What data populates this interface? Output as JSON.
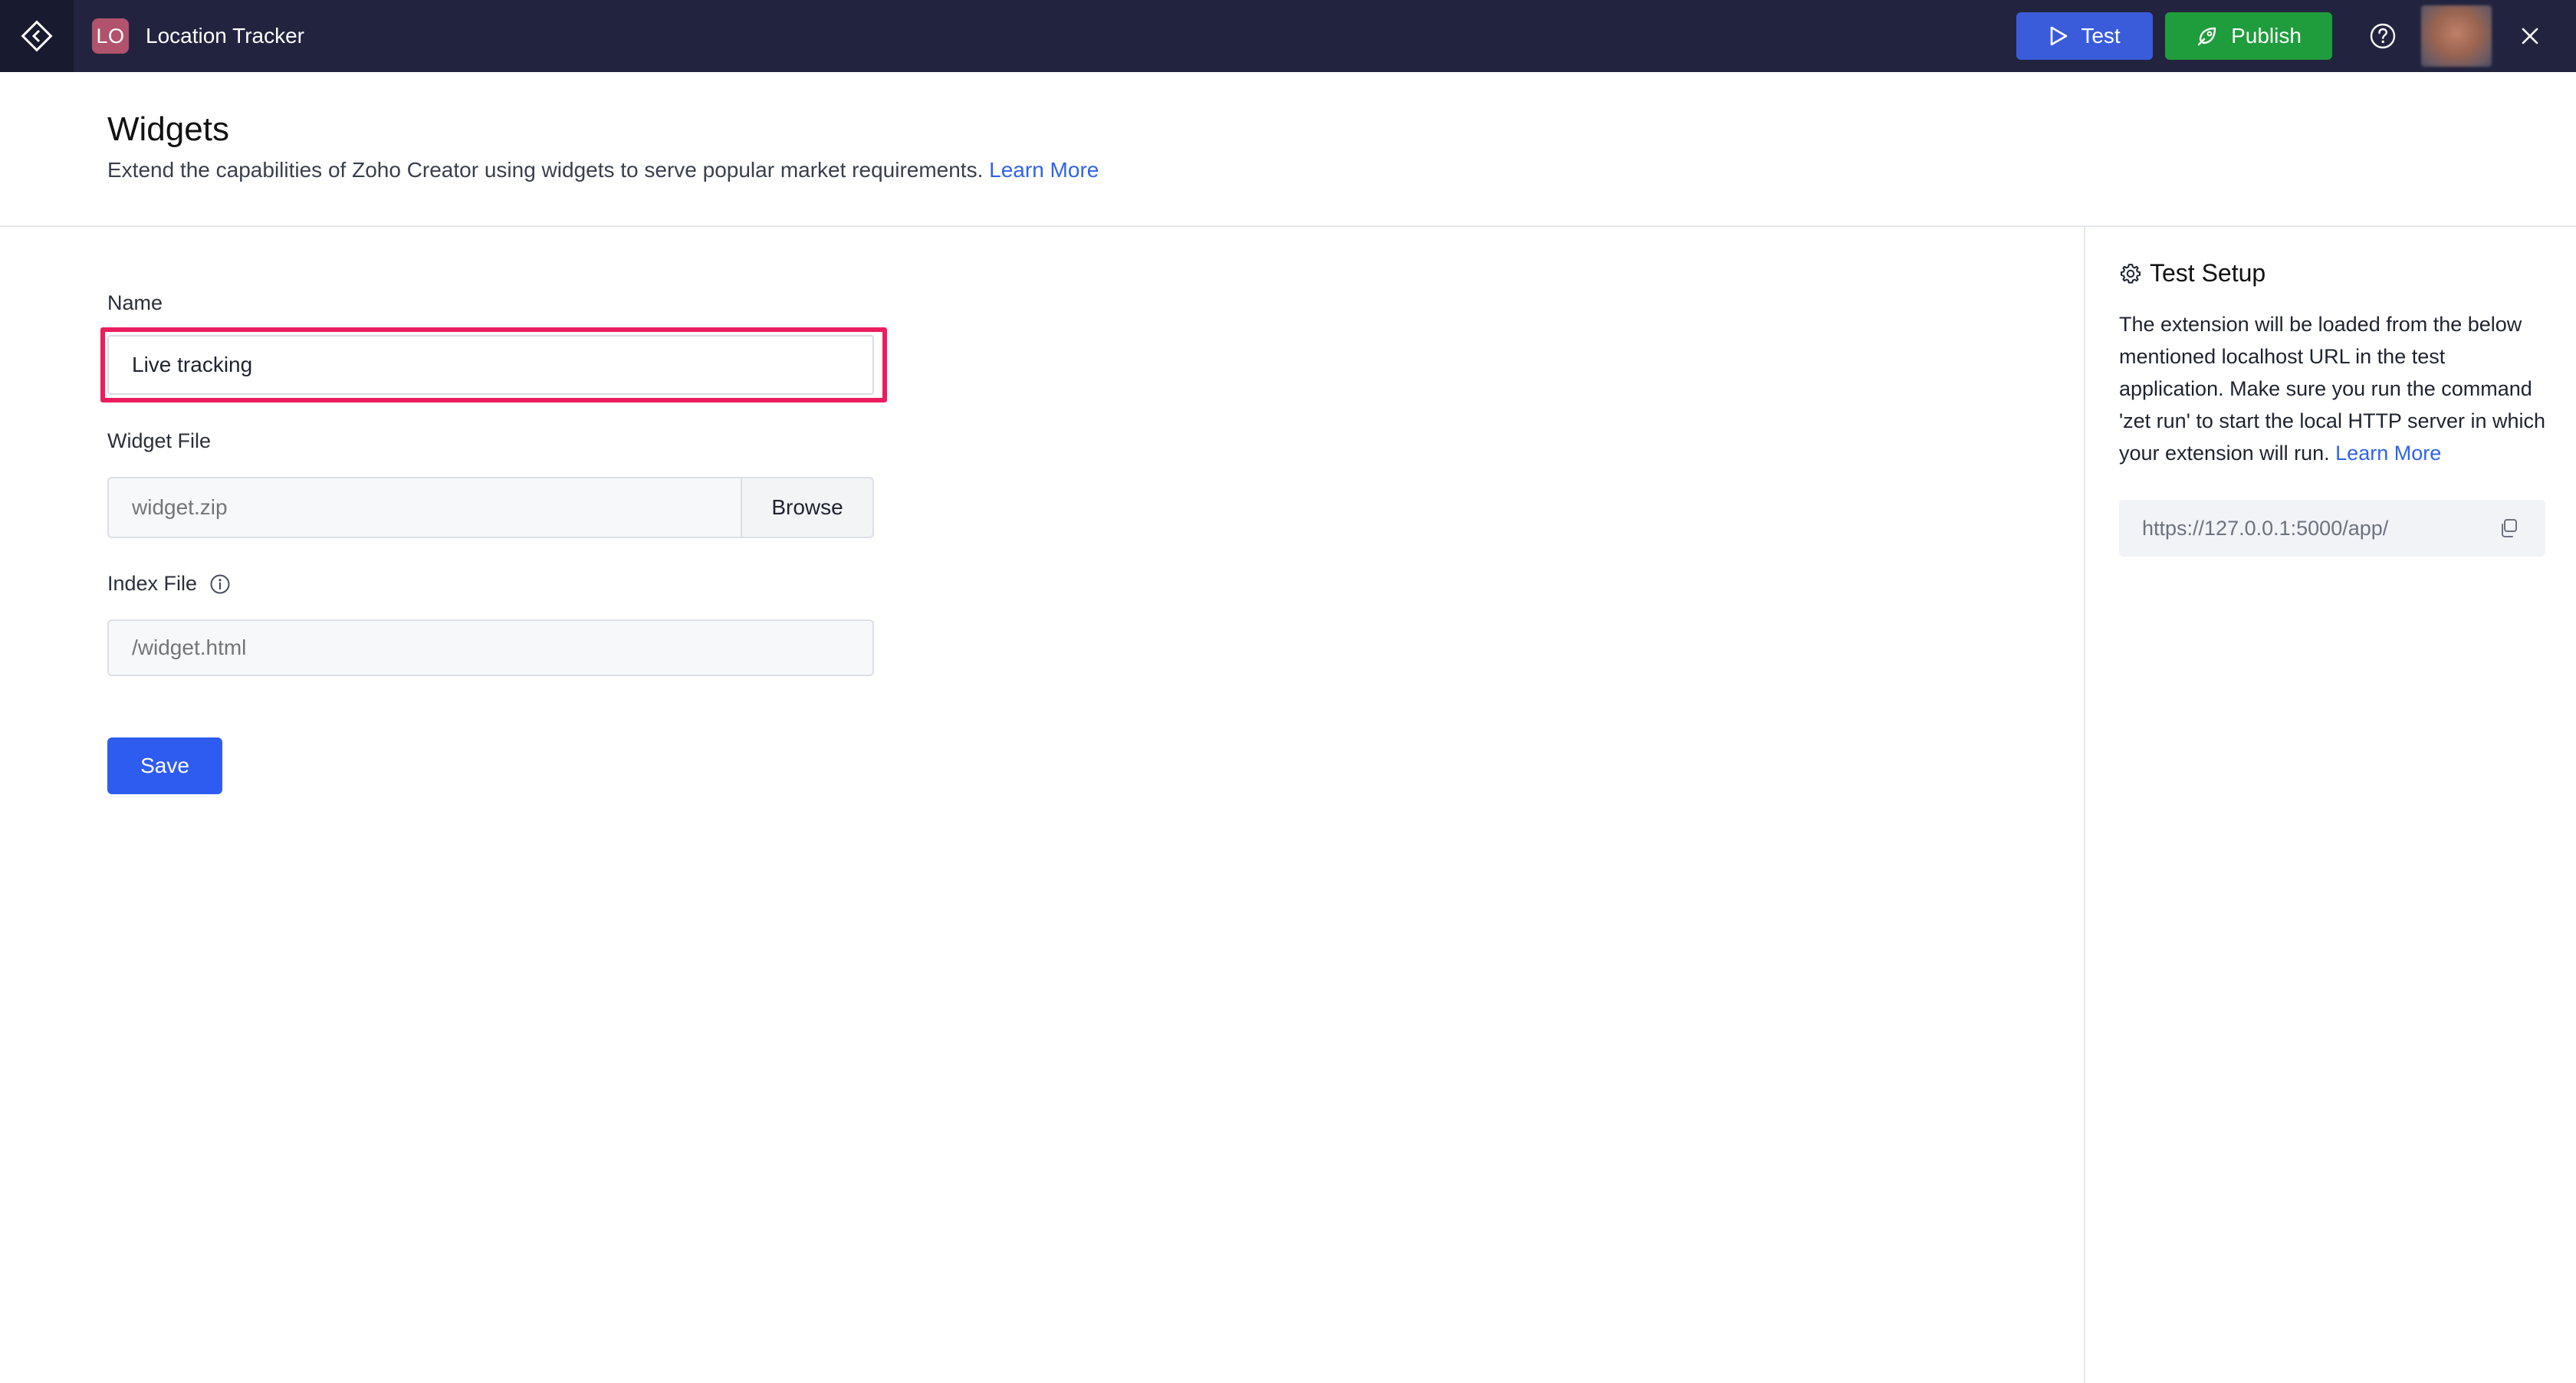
{
  "topbar": {
    "home_icon": "home-diamond-icon",
    "app_badge": "LO",
    "app_name": "Location Tracker",
    "test_label": "Test",
    "test_icon": "play-icon",
    "publish_label": "Publish",
    "publish_icon": "rocket-icon",
    "help_icon": "help-circle-icon",
    "close_icon": "close-icon",
    "colors": {
      "background": "#22243f",
      "test": "#3a5cdb",
      "publish": "#1f9d3c",
      "badge": "#b1536d"
    }
  },
  "header": {
    "title": "Widgets",
    "subtitle": "Extend the capabilities of Zoho Creator using widgets to serve popular market requirements.",
    "learn_more": "Learn More"
  },
  "form": {
    "name_label": "Name",
    "name_value": "Live tracking",
    "widget_file_label": "Widget File",
    "widget_file_placeholder": "widget.zip",
    "browse_label": "Browse",
    "index_file_label": "Index File",
    "index_file_info_icon": "info-icon",
    "index_file_placeholder": "/widget.html",
    "save_label": "Save",
    "highlight_color": "#ec1d5f"
  },
  "test_setup": {
    "icon": "gear-icon",
    "title": "Test Setup",
    "description": "The extension will be loaded from the below mentioned localhost URL in the test application. Make sure you run the command 'zet run' to start the local HTTP server in which your extension will run.",
    "learn_more": "Learn More",
    "url": "https://127.0.0.1:5000/app/",
    "copy_icon": "copy-icon"
  }
}
